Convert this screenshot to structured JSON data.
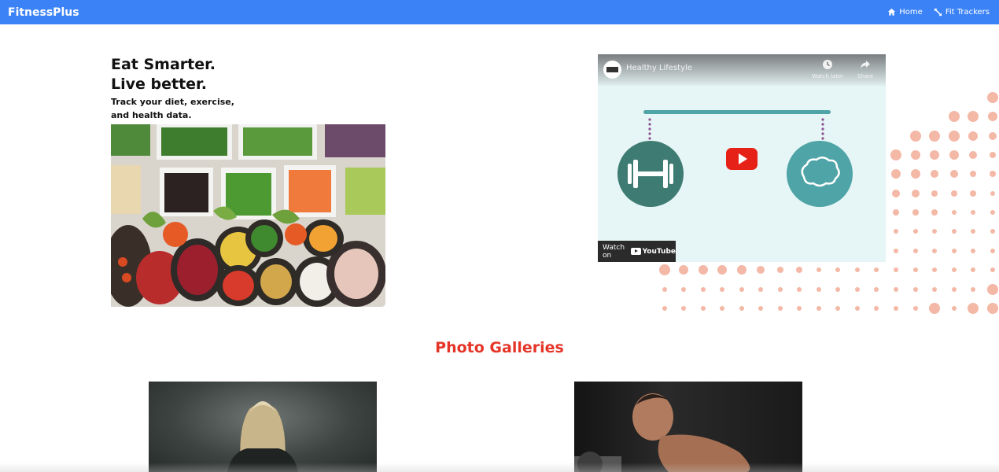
{
  "navbar": {
    "brand": "FitnessPlus",
    "links": [
      {
        "label": "Home",
        "icon": "home-icon"
      },
      {
        "label": "Fit Trackers",
        "icon": "expand-icon"
      }
    ],
    "color": "#3b82f6"
  },
  "hero": {
    "title_line1": "Eat Smarter.",
    "title_line2": "Live better.",
    "subtitle_line1": "Track your diet, exercise,",
    "subtitle_line2": "and health data."
  },
  "video": {
    "title": "Healthy Lifestyle",
    "watch_later": "Watch later",
    "share": "Share",
    "watch_on": "Watch on",
    "provider": "YouTube"
  },
  "gallery": {
    "title": "Photo Galleries",
    "title_color": "#e53528"
  },
  "colors": {
    "dots": "#f4b8a6",
    "teal": "#4ea4a6",
    "dark_teal": "#3e7b72"
  }
}
